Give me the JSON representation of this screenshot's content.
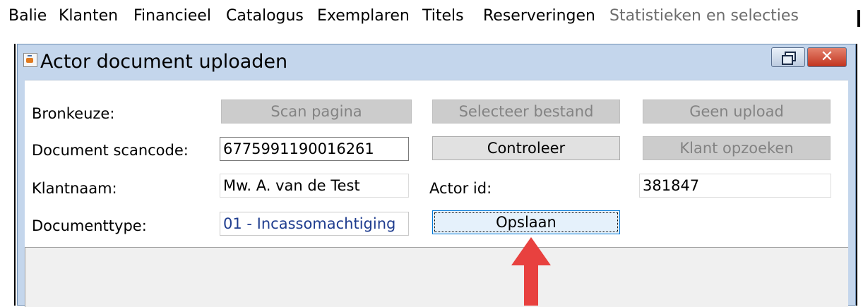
{
  "menu": {
    "items": [
      {
        "label": "Balie",
        "enabled": true
      },
      {
        "label": "Klanten",
        "enabled": true
      },
      {
        "label": "Financieel",
        "enabled": true
      },
      {
        "label": "Catalogus",
        "enabled": true
      },
      {
        "label": "Exemplaren",
        "enabled": true
      },
      {
        "label": "Titels",
        "enabled": true
      },
      {
        "label": "Reserveringen",
        "enabled": true
      },
      {
        "label": "Statistieken en selecties",
        "enabled": false
      }
    ]
  },
  "dialog": {
    "title": "Actor document uploaden",
    "close_glyph": "✕",
    "fields": {
      "bronkeuze_label": "Bronkeuze:",
      "scancode_label": "Document scancode:",
      "scancode_value": "6775991190016261",
      "klantnaam_label": "Klantnaam:",
      "klantnaam_value": "Mw.  A. van de Test",
      "actor_id_label": "Actor id:",
      "actor_id_value": "381847",
      "documenttype_label": "Documenttype:",
      "documenttype_value": "01 - Incassomachtiging"
    },
    "buttons": {
      "scan_pagina": "Scan pagina",
      "selecteer_bestand": "Selecteer bestand",
      "geen_upload": "Geen upload",
      "controleer": "Controleer",
      "klant_opzoeken": "Klant opzoeken",
      "opslaan": "Opslaan"
    }
  },
  "colors": {
    "title_bar": "#c4d6ec",
    "annotation_arrow": "#e8413f",
    "document_type_text": "#1f3d8f"
  }
}
